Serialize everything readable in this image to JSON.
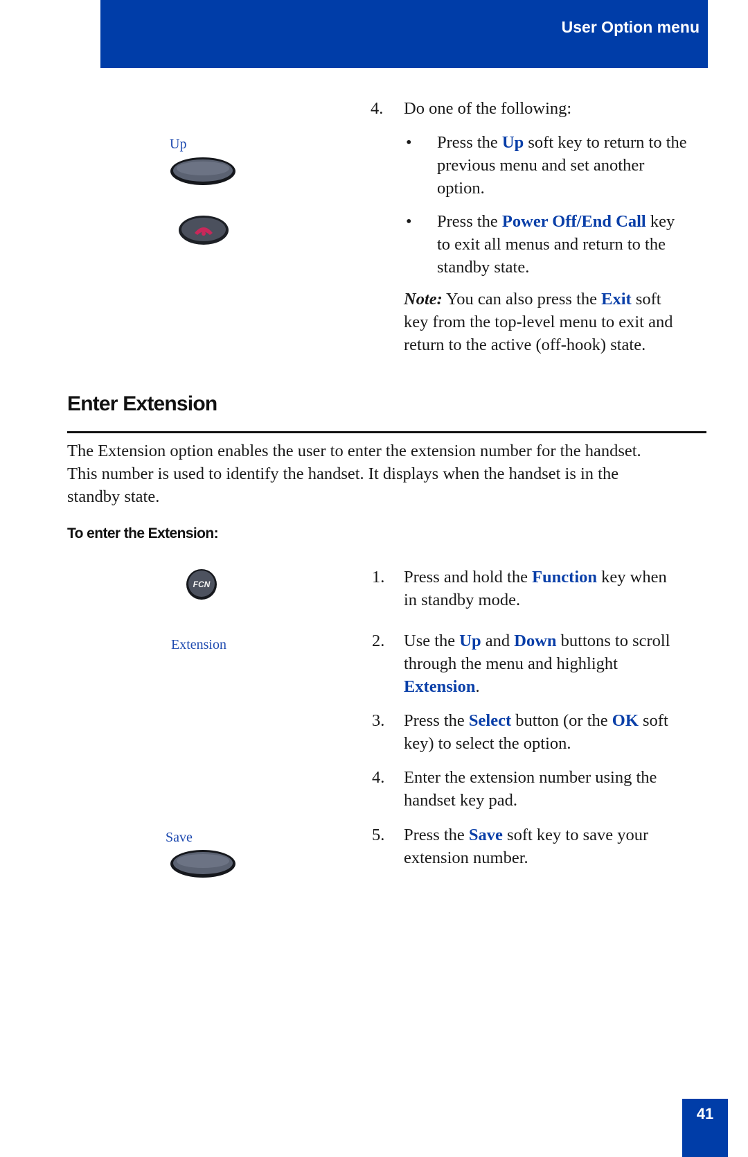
{
  "header": {
    "title": "User Option menu"
  },
  "colors": {
    "brand_blue": "#003da8",
    "keyword_blue": "#0a3fa8",
    "end_call_red": "#c8285a"
  },
  "top_section": {
    "step4": {
      "number": "4.",
      "text": "Do one of the following:",
      "bullets": [
        {
          "marker": "•",
          "pre": "Press the ",
          "key": "Up",
          "post_line1": " soft key to return to the",
          "line2": "previous menu and set another",
          "line3": "option."
        },
        {
          "marker": "•",
          "pre": "Press the ",
          "key": "Power Off/End Call",
          "post_line1": " key",
          "line2": "to exit all menus and return to the",
          "line3": "standby state."
        }
      ]
    },
    "note": {
      "label": "Note:",
      "pre": " You can also press the ",
      "key": "Exit",
      "post_line1": " soft",
      "line2": "key from the top-level menu to exit and",
      "line3": "return to the active (off-hook) state."
    },
    "side_icons": {
      "up_label": "Up",
      "up_icon": "soft-key-button",
      "end_call_icon": "end-call-key"
    }
  },
  "section": {
    "title": "Enter Extension",
    "intro_lines": [
      "The Extension option enables the user to enter the extension number for the handset.",
      "This number is used to identify the handset. It displays when the handset is in the",
      "standby state."
    ],
    "procedure_title": "To enter the Extension:",
    "side_icons": {
      "fcn_label": "FCN",
      "extension_label": "Extension",
      "save_label": "Save"
    },
    "steps": [
      {
        "number": "1.",
        "pre": "Press and hold the ",
        "k1": "Function",
        "mid": " key when",
        "line2": "in standby mode."
      },
      {
        "number": "2.",
        "pre": "Use the ",
        "k1": "Up",
        "mid": " and ",
        "k2": "Down",
        "post": " buttons to scroll",
        "line2": "through the menu and highlight",
        "line3_key": "Extension",
        "line3_post": "."
      },
      {
        "number": "3.",
        "pre": "Press the ",
        "k1": "Select",
        "mid": " button (or the ",
        "k2": "OK",
        "post": " soft",
        "line2": "key) to select the option."
      },
      {
        "number": "4.",
        "line1": "Enter the extension number using the",
        "line2": "handset key pad."
      },
      {
        "number": "5.",
        "pre": "Press the ",
        "k1": "Save",
        "mid": " soft key to save your",
        "line2": "extension number."
      }
    ]
  },
  "footer": {
    "page_number": "41"
  }
}
